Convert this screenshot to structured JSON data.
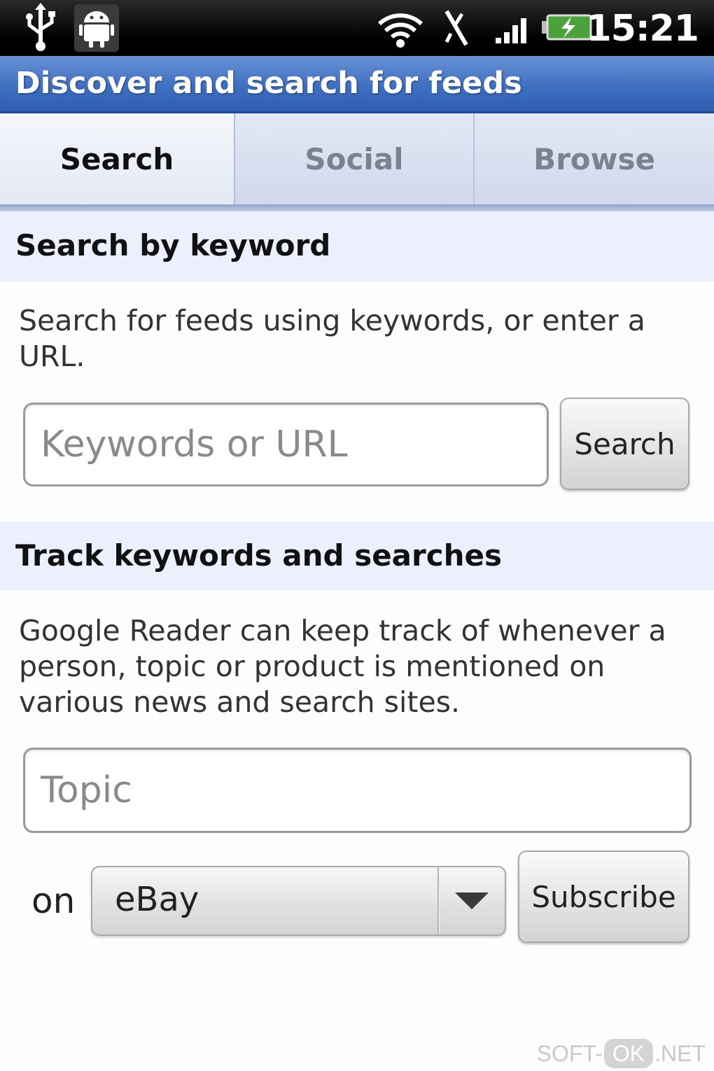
{
  "status_bar": {
    "time": "15:21",
    "icons": [
      "usb-icon",
      "android-debug-icon",
      "wifi-icon",
      "no-signal-x-icon",
      "signal-bars-icon",
      "battery-charging-icon"
    ]
  },
  "title_bar": {
    "title": "Discover and search for feeds"
  },
  "tabs": [
    {
      "label": "Search",
      "active": true
    },
    {
      "label": "Social",
      "active": false
    },
    {
      "label": "Browse",
      "active": false
    }
  ],
  "search_section": {
    "header": "Search by keyword",
    "description": "Search for feeds using keywords, or enter a URL.",
    "input_placeholder": "Keywords or URL",
    "input_value": "",
    "button_label": "Search"
  },
  "track_section": {
    "header": "Track keywords and searches",
    "description": "Google Reader can keep track of whenever a person, topic or product is mentioned on various news and search sites.",
    "topic_placeholder": "Topic",
    "topic_value": "",
    "on_label": "on",
    "site_selected": "eBay",
    "subscribe_label": "Subscribe"
  },
  "watermark": {
    "left": "SOFT-",
    "ok": "OK",
    "right": ".NET"
  },
  "colors": {
    "title_bar": "#3f6fc0",
    "section_header_bg": "#eceffc",
    "tab_inactive_text": "#7a8292"
  }
}
